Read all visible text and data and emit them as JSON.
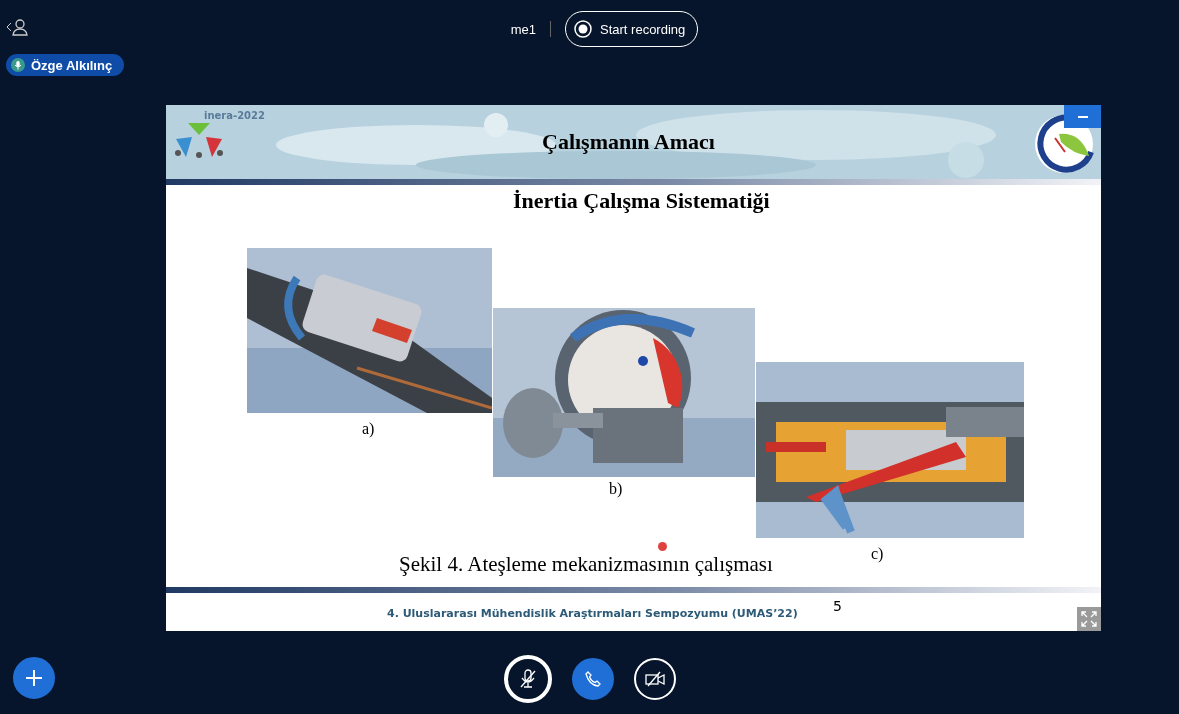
{
  "top_bar": {
    "meeting_name": "me1",
    "record_button": "Start recording"
  },
  "participant": {
    "name": "Özge Alkılınç"
  },
  "slide": {
    "logo_text": "inera-2022",
    "title": "Çalışmanın Amacı",
    "subtitle": "İnertia Çalışma Sistematiği",
    "figures": [
      {
        "kind": "picture",
        "label": "a)"
      },
      {
        "kind": "picture",
        "label": "b)"
      },
      {
        "kind": "picture",
        "label": "c)"
      }
    ],
    "caption": "Şekil 4. Ateşleme mekanizmasının çalışması",
    "footer": "4. Uluslararası Mühendislik Araştırmaları Sempozyumu (UMAS’22)",
    "page_number": "5"
  },
  "controls": {
    "mic_muted": true,
    "camera_off": true
  }
}
